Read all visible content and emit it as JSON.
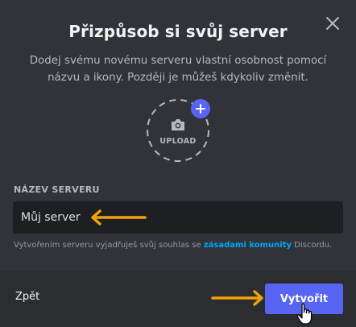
{
  "dialog": {
    "title": "Přizpůsob si svůj server",
    "subtitle": "Dodej svému novému serveru vlastní osobnost pomocí názvu a ikony. Později je můžeš kdykoliv změnit.",
    "close_icon": "close-icon"
  },
  "upload": {
    "label": "UPLOAD",
    "icon": "camera-icon",
    "badge_icon": "plus-icon"
  },
  "server_name": {
    "label": "NÁZEV SERVERU",
    "value": "Můj server"
  },
  "agreement": {
    "prefix": "Vytvořením serveru vyjadřuješ svůj souhlas se ",
    "link": "zásadami komunity",
    "suffix": " Discordu."
  },
  "footer": {
    "back_label": "Zpět",
    "create_label": "Vytvořit"
  },
  "colors": {
    "background": "#313338",
    "footer": "#2b2d31",
    "accent": "#5865f2",
    "link": "#00a8fc",
    "annotation_arrow": "#f0a30a"
  }
}
